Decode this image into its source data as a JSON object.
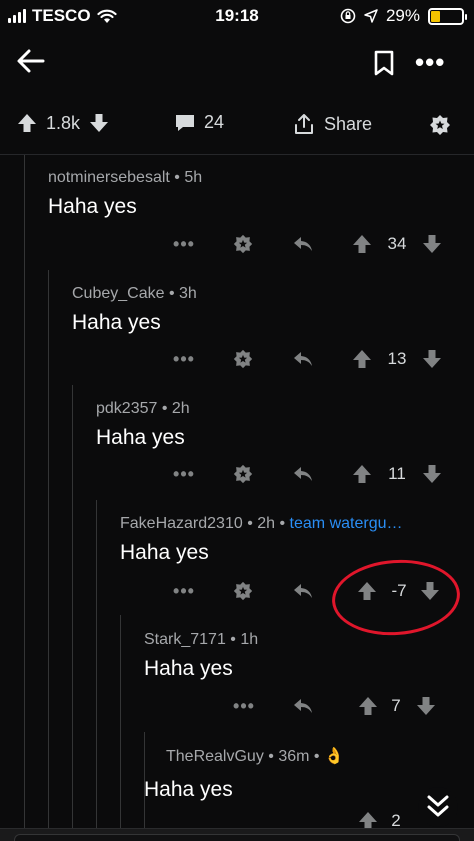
{
  "status_bar": {
    "carrier": "TESCO",
    "time": "19:18",
    "battery": "29%",
    "battery_level": 0.29,
    "icons": [
      "signal-icon",
      "wifi-icon",
      "rotation-lock-icon",
      "location-icon",
      "battery-icon"
    ]
  },
  "nav": {
    "icons": [
      "back-arrow-icon",
      "bookmark-icon",
      "more-icon"
    ],
    "more_label": "•••"
  },
  "post_actions": {
    "vote_count": "1.8k",
    "comment_count": "24",
    "share_label": "Share"
  },
  "colors": {
    "background": "#0b0b0c",
    "flair": "#2a8ef5",
    "highlight": "#e0162b",
    "icon": "#818384"
  },
  "comments": [
    {
      "author": "notminersebesalt",
      "age": "5h",
      "body": "Haha yes",
      "score": "34",
      "dots": "•••"
    },
    {
      "author": "Cubey_Cake",
      "age": "3h",
      "body": "Haha yes",
      "score": "13",
      "dots": "•••"
    },
    {
      "author": "pdk2357",
      "age": "2h",
      "body": "Haha yes",
      "score": "11",
      "dots": "•••"
    },
    {
      "author": "FakeHazard2310",
      "age": "2h",
      "flair": "team watergu…",
      "body": "Haha yes",
      "score": "-7",
      "dots": "•••"
    },
    {
      "author": "Stark_7171",
      "age": "1h",
      "body": "Haha yes",
      "score": "7",
      "dots": "•••"
    },
    {
      "author": "TheRealvGuy",
      "age": "36m",
      "emoji": "👌",
      "body": "Haha yes",
      "score": "2"
    }
  ],
  "meta_separator": " • "
}
